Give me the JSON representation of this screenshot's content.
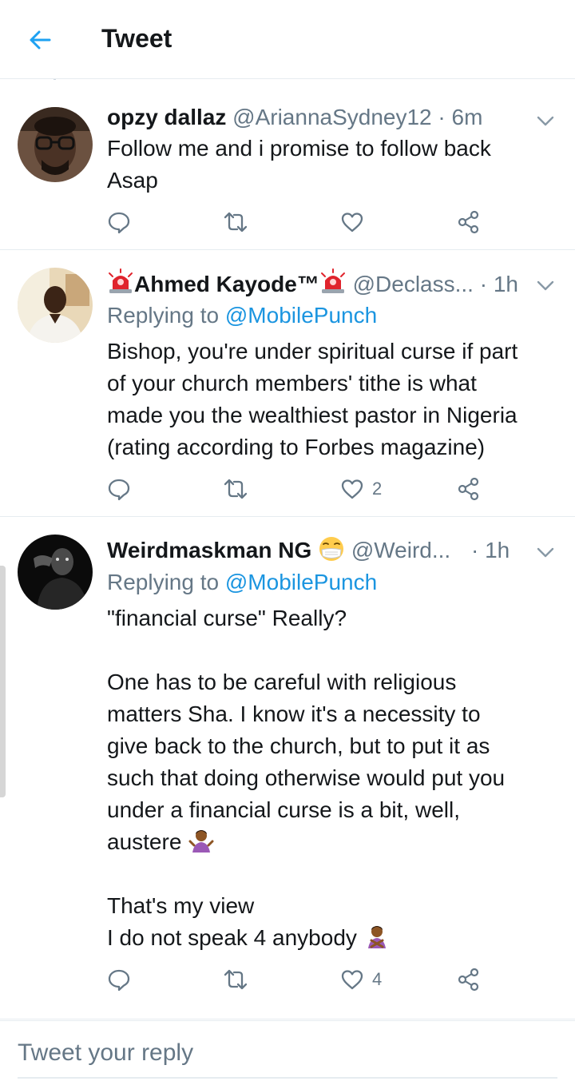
{
  "header": {
    "title": "Tweet"
  },
  "tweets": [
    {
      "name": "opzy dallaz",
      "handle": "@AriannaSydney12",
      "separator": "·",
      "time": "6m",
      "lines": [
        "Follow me and i promise to follow back",
        "Asap"
      ],
      "actions": {
        "reply_count": "",
        "retweet_count": "",
        "like_count": ""
      }
    },
    {
      "name": "Ahmed Kayode™",
      "name_badge": "siren-emoji",
      "handle": "@Declass...",
      "separator": "·",
      "time": "1h",
      "reply_prefix": "Replying to ",
      "reply_mention": "@MobilePunch",
      "lines": [
        "Bishop, you're under spiritual curse if part",
        "of your church members' tithe is what",
        "made you the wealthiest pastor in Nigeria",
        "(rating according to Forbes magazine)"
      ],
      "actions": {
        "reply_count": "",
        "retweet_count": "",
        "like_count": "2"
      }
    },
    {
      "name": "Weirdmaskman NG",
      "name_badge": "face-with-mask-emoji",
      "handle": "@Weird...",
      "separator": "·",
      "time": "1h",
      "reply_prefix": "Replying to ",
      "reply_mention": "@MobilePunch",
      "paragraph1": "\"financial curse\" Really?",
      "paragraph2_lines": [
        "One has to be careful with religious",
        "matters Sha. I know it's a necessity to",
        "give back to the church, but to put it as",
        "such that doing otherwise would put you",
        "under a financial curse is a bit, well,",
        "austere"
      ],
      "paragraph3_lines": [
        "That's my view",
        "I do not speak 4 anybody"
      ],
      "inline_emoji": "person-shrugging-emoji",
      "actions": {
        "reply_count": "",
        "retweet_count": "",
        "like_count": "4"
      }
    }
  ],
  "reply_bar": {
    "placeholder": "Tweet your reply"
  },
  "colors": {
    "accent": "#1da1f2",
    "mention": "#1b95e0",
    "muted": "#657786",
    "divider": "#e6ecf0",
    "text": "#14171a"
  },
  "icons": [
    "back-arrow-icon",
    "chevron-down-icon",
    "reply-icon",
    "retweet-icon",
    "like-icon",
    "share-icon"
  ]
}
